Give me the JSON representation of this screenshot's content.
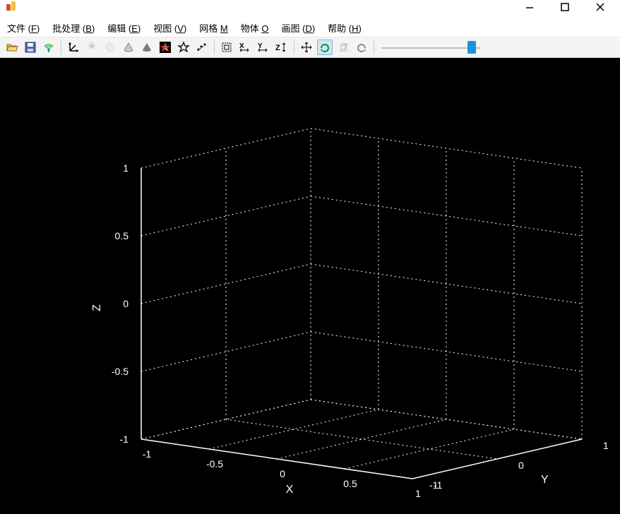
{
  "window": {
    "minimize": "—",
    "maximize": "□",
    "close": "×"
  },
  "menu": {
    "file": {
      "label": "文件",
      "accel": "F"
    },
    "batch": {
      "label": "批处理",
      "accel": "B"
    },
    "edit": {
      "label": "编辑",
      "accel": "E"
    },
    "view": {
      "label": "视图",
      "accel": "V"
    },
    "mesh": {
      "label": "网格",
      "accel": "M"
    },
    "object": {
      "label": "物体",
      "accel": "O"
    },
    "draw": {
      "label": "画图",
      "accel": "D"
    },
    "help": {
      "label": "帮助",
      "accel": "H"
    }
  },
  "toolbar": {
    "buttons": [
      {
        "name": "open-icon"
      },
      {
        "name": "save-icon"
      },
      {
        "name": "broadcast-icon"
      },
      {
        "name": "axes-icon"
      },
      {
        "name": "light-icon"
      },
      {
        "name": "wireframe-icon"
      },
      {
        "name": "shade-cone-icon"
      },
      {
        "name": "solid-cone-icon"
      },
      {
        "name": "color-star-icon"
      },
      {
        "name": "star-outline-icon"
      },
      {
        "name": "scatter-line-icon"
      },
      {
        "name": "bbox-icon"
      },
      {
        "name": "x-axis-icon"
      },
      {
        "name": "y-axis-icon"
      },
      {
        "name": "z-axis-icon"
      },
      {
        "name": "move-icon"
      },
      {
        "name": "rotate-icon"
      },
      {
        "name": "rotate-cube-icon"
      },
      {
        "name": "undo-icon"
      }
    ],
    "active_index": 16,
    "slider_value": 0.95
  },
  "chart_data": {
    "type": "scatter",
    "title": "",
    "series": [],
    "x_axis": {
      "label": "X",
      "range": [
        -1,
        1
      ],
      "ticks": [
        -1,
        -0.5,
        0,
        0.5,
        1
      ]
    },
    "y_axis": {
      "label": "Y",
      "range": [
        -1,
        1
      ],
      "ticks": [
        -1,
        0,
        1
      ]
    },
    "z_axis": {
      "label": "Z",
      "range": [
        -1,
        1
      ],
      "ticks": [
        -1,
        -0.5,
        0,
        0.5,
        1
      ]
    },
    "grid": true,
    "background": "#000000",
    "foreground": "#ffffff"
  }
}
